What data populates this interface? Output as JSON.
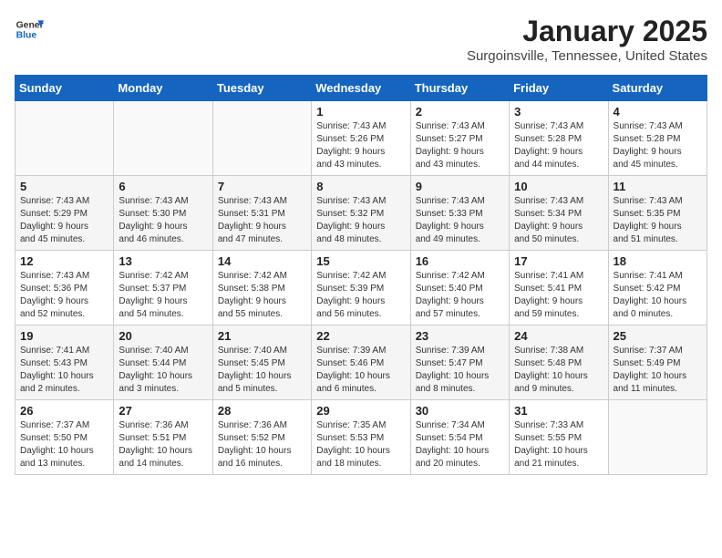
{
  "logo": {
    "line1": "General",
    "line2": "Blue"
  },
  "title": "January 2025",
  "location": "Surgoinsville, Tennessee, United States",
  "days_of_week": [
    "Sunday",
    "Monday",
    "Tuesday",
    "Wednesday",
    "Thursday",
    "Friday",
    "Saturday"
  ],
  "weeks": [
    [
      {
        "day": "",
        "info": ""
      },
      {
        "day": "",
        "info": ""
      },
      {
        "day": "",
        "info": ""
      },
      {
        "day": "1",
        "info": "Sunrise: 7:43 AM\nSunset: 5:26 PM\nDaylight: 9 hours\nand 43 minutes."
      },
      {
        "day": "2",
        "info": "Sunrise: 7:43 AM\nSunset: 5:27 PM\nDaylight: 9 hours\nand 43 minutes."
      },
      {
        "day": "3",
        "info": "Sunrise: 7:43 AM\nSunset: 5:28 PM\nDaylight: 9 hours\nand 44 minutes."
      },
      {
        "day": "4",
        "info": "Sunrise: 7:43 AM\nSunset: 5:28 PM\nDaylight: 9 hours\nand 45 minutes."
      }
    ],
    [
      {
        "day": "5",
        "info": "Sunrise: 7:43 AM\nSunset: 5:29 PM\nDaylight: 9 hours\nand 45 minutes."
      },
      {
        "day": "6",
        "info": "Sunrise: 7:43 AM\nSunset: 5:30 PM\nDaylight: 9 hours\nand 46 minutes."
      },
      {
        "day": "7",
        "info": "Sunrise: 7:43 AM\nSunset: 5:31 PM\nDaylight: 9 hours\nand 47 minutes."
      },
      {
        "day": "8",
        "info": "Sunrise: 7:43 AM\nSunset: 5:32 PM\nDaylight: 9 hours\nand 48 minutes."
      },
      {
        "day": "9",
        "info": "Sunrise: 7:43 AM\nSunset: 5:33 PM\nDaylight: 9 hours\nand 49 minutes."
      },
      {
        "day": "10",
        "info": "Sunrise: 7:43 AM\nSunset: 5:34 PM\nDaylight: 9 hours\nand 50 minutes."
      },
      {
        "day": "11",
        "info": "Sunrise: 7:43 AM\nSunset: 5:35 PM\nDaylight: 9 hours\nand 51 minutes."
      }
    ],
    [
      {
        "day": "12",
        "info": "Sunrise: 7:43 AM\nSunset: 5:36 PM\nDaylight: 9 hours\nand 52 minutes."
      },
      {
        "day": "13",
        "info": "Sunrise: 7:42 AM\nSunset: 5:37 PM\nDaylight: 9 hours\nand 54 minutes."
      },
      {
        "day": "14",
        "info": "Sunrise: 7:42 AM\nSunset: 5:38 PM\nDaylight: 9 hours\nand 55 minutes."
      },
      {
        "day": "15",
        "info": "Sunrise: 7:42 AM\nSunset: 5:39 PM\nDaylight: 9 hours\nand 56 minutes."
      },
      {
        "day": "16",
        "info": "Sunrise: 7:42 AM\nSunset: 5:40 PM\nDaylight: 9 hours\nand 57 minutes."
      },
      {
        "day": "17",
        "info": "Sunrise: 7:41 AM\nSunset: 5:41 PM\nDaylight: 9 hours\nand 59 minutes."
      },
      {
        "day": "18",
        "info": "Sunrise: 7:41 AM\nSunset: 5:42 PM\nDaylight: 10 hours\nand 0 minutes."
      }
    ],
    [
      {
        "day": "19",
        "info": "Sunrise: 7:41 AM\nSunset: 5:43 PM\nDaylight: 10 hours\nand 2 minutes."
      },
      {
        "day": "20",
        "info": "Sunrise: 7:40 AM\nSunset: 5:44 PM\nDaylight: 10 hours\nand 3 minutes."
      },
      {
        "day": "21",
        "info": "Sunrise: 7:40 AM\nSunset: 5:45 PM\nDaylight: 10 hours\nand 5 minutes."
      },
      {
        "day": "22",
        "info": "Sunrise: 7:39 AM\nSunset: 5:46 PM\nDaylight: 10 hours\nand 6 minutes."
      },
      {
        "day": "23",
        "info": "Sunrise: 7:39 AM\nSunset: 5:47 PM\nDaylight: 10 hours\nand 8 minutes."
      },
      {
        "day": "24",
        "info": "Sunrise: 7:38 AM\nSunset: 5:48 PM\nDaylight: 10 hours\nand 9 minutes."
      },
      {
        "day": "25",
        "info": "Sunrise: 7:37 AM\nSunset: 5:49 PM\nDaylight: 10 hours\nand 11 minutes."
      }
    ],
    [
      {
        "day": "26",
        "info": "Sunrise: 7:37 AM\nSunset: 5:50 PM\nDaylight: 10 hours\nand 13 minutes."
      },
      {
        "day": "27",
        "info": "Sunrise: 7:36 AM\nSunset: 5:51 PM\nDaylight: 10 hours\nand 14 minutes."
      },
      {
        "day": "28",
        "info": "Sunrise: 7:36 AM\nSunset: 5:52 PM\nDaylight: 10 hours\nand 16 minutes."
      },
      {
        "day": "29",
        "info": "Sunrise: 7:35 AM\nSunset: 5:53 PM\nDaylight: 10 hours\nand 18 minutes."
      },
      {
        "day": "30",
        "info": "Sunrise: 7:34 AM\nSunset: 5:54 PM\nDaylight: 10 hours\nand 20 minutes."
      },
      {
        "day": "31",
        "info": "Sunrise: 7:33 AM\nSunset: 5:55 PM\nDaylight: 10 hours\nand 21 minutes."
      },
      {
        "day": "",
        "info": ""
      }
    ]
  ]
}
